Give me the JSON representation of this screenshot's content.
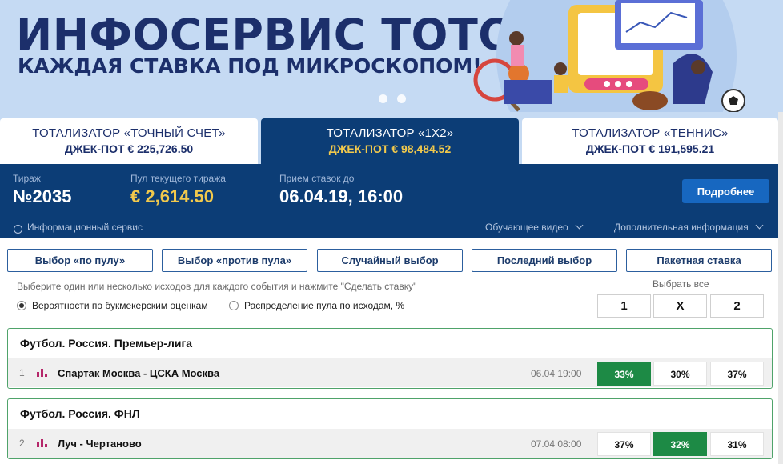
{
  "banner": {
    "title": "ИНФОСЕРВИС ТОТО",
    "subtitle": "КАЖДАЯ СТАВКА ПОД МИКРОСКОПОМ!"
  },
  "tabs": [
    {
      "title": "ТОТАЛИЗАТОР «ТОЧНЫЙ СЧЕТ»",
      "jackpot": "ДЖЕК-ПОТ € 225,726.50",
      "active": false
    },
    {
      "title": "ТОТАЛИЗАТОР «1Х2»",
      "jackpot": "ДЖЕК-ПОТ € 98,484.52",
      "active": true
    },
    {
      "title": "ТОТАЛИЗАТОР «ТЕННИС»",
      "jackpot": "ДЖЕК-ПОТ € 191,595.21",
      "active": false
    }
  ],
  "draw": {
    "draw_label": "Тираж",
    "draw_value": "№2035",
    "pool_label": "Пул текущего тиража",
    "pool_value": "€ 2,614.50",
    "deadline_label": "Прием ставок до",
    "deadline_value": "06.04.19, 16:00",
    "more_button": "Подробнее",
    "info_service": "Информационный сервис",
    "video": "Обучающее видео",
    "extra_info": "Дополнительная информация"
  },
  "selection_buttons": [
    "Выбор «по пулу»",
    "Выбор «против пула»",
    "Случайный выбор",
    "Последний выбор",
    "Пакетная ставка"
  ],
  "hint": "Выберите один или несколько исходов для каждого события и нажмите \"Сделать ставку\"",
  "radios": [
    {
      "label": "Вероятности по букмекерским оценкам",
      "checked": true
    },
    {
      "label": "Распределение пула по исходам, %",
      "checked": false
    }
  ],
  "choose_all": {
    "label": "Выбрать все",
    "options": [
      "1",
      "X",
      "2"
    ]
  },
  "events": [
    {
      "league": "Футбол. Россия. Премьер-лига",
      "number": "1",
      "match": "Спартак Москва - ЦСКА Москва",
      "date": "06.04 19:00",
      "odds": [
        "33%",
        "30%",
        "37%"
      ],
      "selected": 0
    },
    {
      "league": "Футбол. Россия. ФНЛ",
      "number": "2",
      "match": "Луч - Чертаново",
      "date": "07.04 08:00",
      "odds": [
        "37%",
        "32%",
        "31%"
      ],
      "selected": 1
    }
  ],
  "colors": {
    "navy": "#0c3d76",
    "banner_bg": "#c5daf3",
    "gold": "#f2c94c",
    "green": "#1d8a45",
    "button_blue": "#1767c0"
  }
}
